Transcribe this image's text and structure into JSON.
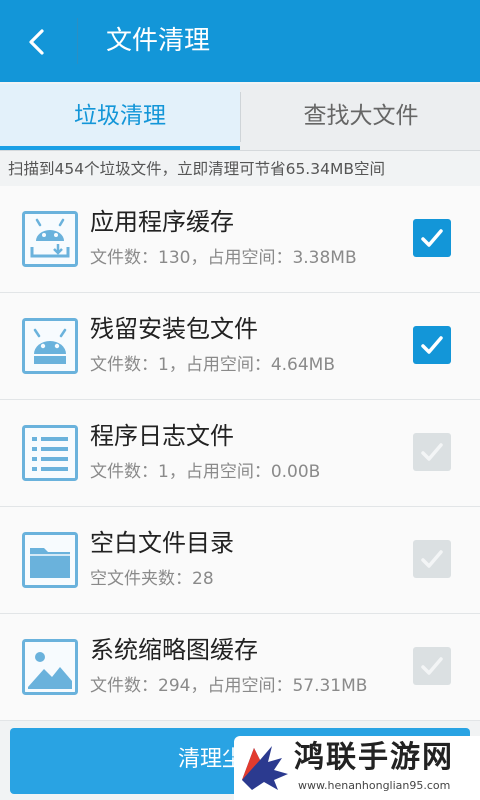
{
  "header": {
    "title": "文件清理"
  },
  "tabs": [
    {
      "label": "垃圾清理",
      "active": true
    },
    {
      "label": "查找大文件",
      "active": false
    }
  ],
  "scan_summary": "扫描到454个垃圾文件，立即清理可节省65.34MB空间",
  "items": [
    {
      "name": "应用程序缓存",
      "detail": "文件数：130，占用空间：3.38MB",
      "checked": true,
      "icon": "android-cache-icon"
    },
    {
      "name": "残留安装包文件",
      "detail": "文件数：1，占用空间：4.64MB",
      "checked": true,
      "icon": "android-package-icon"
    },
    {
      "name": "程序日志文件",
      "detail": "文件数：1，占用空间：0.00B",
      "checked": false,
      "icon": "log-list-icon"
    },
    {
      "name": "空白文件目录",
      "detail": "空文件夹数：28",
      "checked": false,
      "icon": "folder-icon"
    },
    {
      "name": "系统缩略图缓存",
      "detail": "文件数：294，占用空间：57.31MB",
      "checked": false,
      "icon": "image-icon"
    }
  ],
  "clean_button": {
    "label": "清理尘"
  },
  "watermark": {
    "title": "鸿联手游网",
    "url": "www.henanhonglian95.com"
  },
  "colors": {
    "primary": "#1396d8",
    "check_on": "#1396d8",
    "check_off": "#dbe0e2",
    "icon_blue": "#6ab2dc"
  }
}
